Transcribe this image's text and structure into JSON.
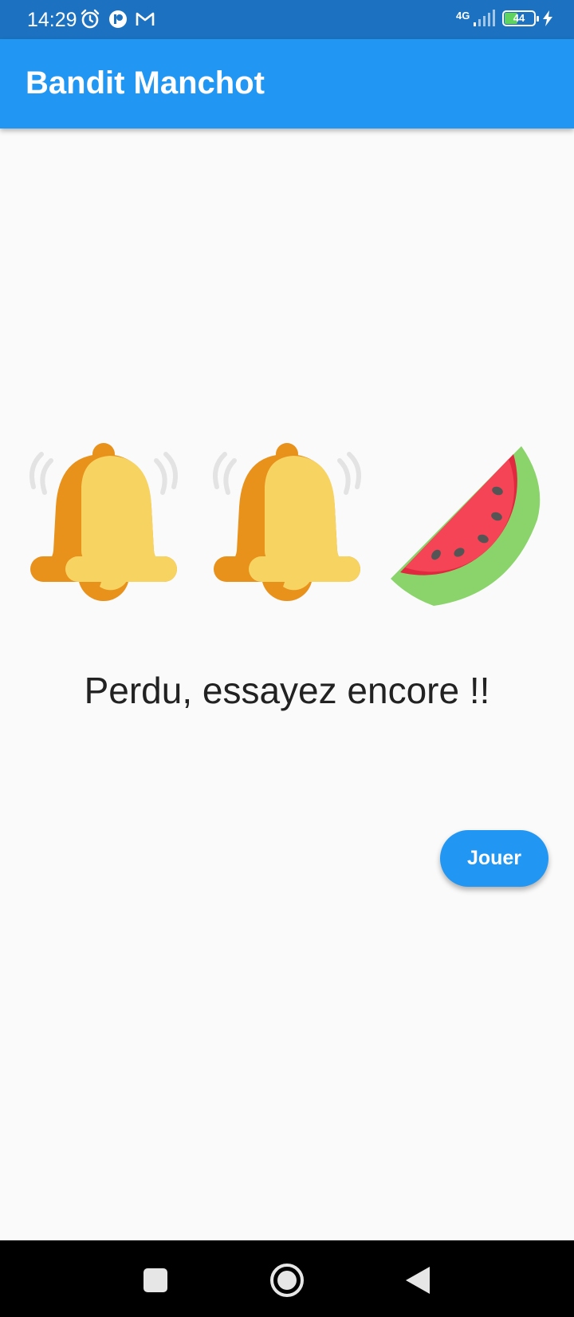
{
  "status_bar": {
    "time": "14:29",
    "network": "4G",
    "battery_level": "44",
    "battery_fraction": 0.44,
    "icons": [
      "alarm-icon",
      "app-notification-icon",
      "gmail-icon",
      "signal-icon",
      "battery-icon",
      "charging-icon"
    ]
  },
  "app_bar": {
    "title": "Bandit Manchot"
  },
  "reels": [
    {
      "symbol": "bell-icon"
    },
    {
      "symbol": "bell-icon"
    },
    {
      "symbol": "watermelon-icon"
    }
  ],
  "result": {
    "message": "Perdu, essayez encore !!"
  },
  "play_button": {
    "label": "Jouer"
  },
  "colors": {
    "status_bar": "#1c72c0",
    "app_bar": "#2196f3",
    "button": "#2196f3",
    "background": "#fafafa",
    "bell_dark": "#e8911b",
    "bell_light": "#f7d362",
    "melon_red": "#f44456",
    "melon_green": "#8bd46b"
  },
  "nav_bar": {
    "icons": [
      "recent-apps-icon",
      "home-icon",
      "back-icon"
    ]
  }
}
